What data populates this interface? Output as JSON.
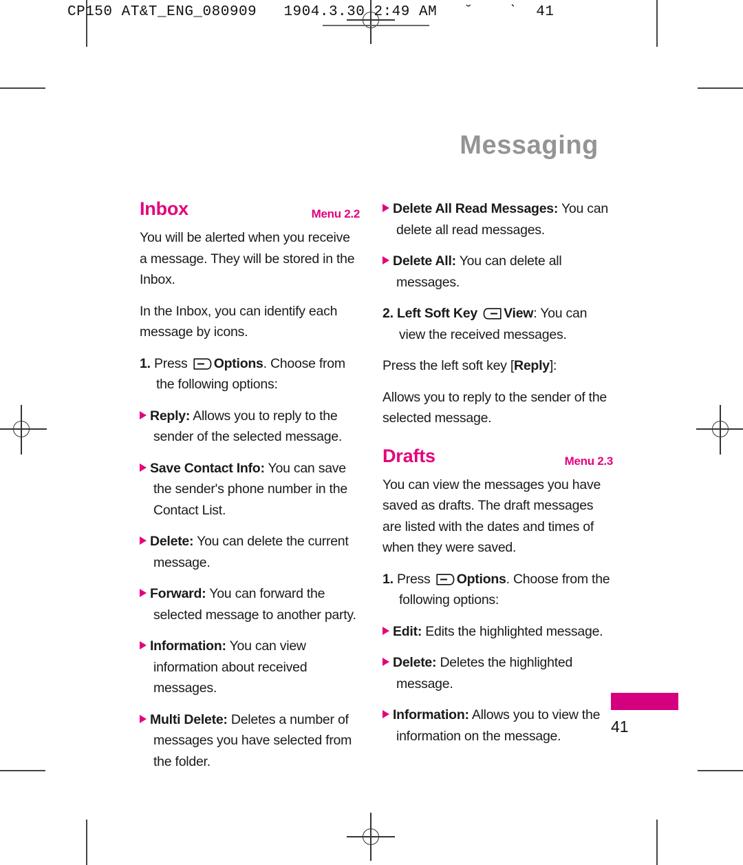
{
  "print_slug": {
    "text": "CP150 AT&T_ENG_080909   1904.3.30 2:49 AM   ˘    ˋ  41"
  },
  "chapter": {
    "title": "Messaging"
  },
  "page_footer": {
    "page_number": "41"
  },
  "icons": {
    "right_soft_key": "right-soft-key-icon",
    "left_soft_key": "left-soft-key-icon",
    "bullet": "triangle-bullet-icon",
    "registration": "registration-mark-icon"
  },
  "colors": {
    "accent_magenta": "#e5007d",
    "tab_bar": "#d4007f",
    "chapter_gray": "#949494",
    "body_text": "#1a1a1a"
  },
  "left_column": {
    "section": {
      "title": "Inbox",
      "menu": "Menu 2.2"
    },
    "paragraph_1": "You will be alerted when you receive a message. They will be stored in the Inbox.",
    "paragraph_2": "In the Inbox, you can identify each message by icons.",
    "step_1": {
      "number": "1.",
      "pre_icon": "Press",
      "bold_label": "Options",
      "post": ". Choose from the following options:"
    },
    "bullets": [
      {
        "label": "Reply:",
        "text": "Allows you to reply to the sender of the selected message."
      },
      {
        "label": "Save Contact Info:",
        "text": "You can save the sender's phone number in the Contact List."
      },
      {
        "label": "Delete:",
        "text": "You can delete the current message."
      },
      {
        "label": "Forward:",
        "text": "You can forward the selected message to another party."
      },
      {
        "label": "Information:",
        "text": "You can view information about received messages."
      },
      {
        "label": "Multi Delete:",
        "text": "Deletes a number of messages you have selected from the folder."
      }
    ]
  },
  "right_column": {
    "inbox_bullets": [
      {
        "label": "Delete All Read Messages:",
        "text": "You can delete all read messages."
      },
      {
        "label": "Delete All:",
        "text": "You can delete all messages."
      }
    ],
    "step_2": {
      "number": "2.",
      "bold_before": "Left Soft Key",
      "bold_after": "View",
      "post": ": You can view the received messages."
    },
    "press_left_soft_key": {
      "pre": "Press the left soft key [",
      "bold": "Reply",
      "post": "]:"
    },
    "reply_description": "Allows you to reply to the sender of the selected message.",
    "section": {
      "title": "Drafts",
      "menu": "Menu 2.3"
    },
    "drafts_paragraph": "You can view the messages you have saved as drafts. The draft messages are listed with the dates and times of when they were saved.",
    "step_1": {
      "number": "1.",
      "pre_icon": "Press",
      "bold_label": "Options",
      "post": ". Choose from the following options:"
    },
    "drafts_bullets": [
      {
        "label": "Edit:",
        "text": "Edits the highlighted message."
      },
      {
        "label": "Delete:",
        "text": "Deletes the highlighted message."
      },
      {
        "label": "Information:",
        "text": "Allows you to view the information on the message."
      }
    ]
  }
}
